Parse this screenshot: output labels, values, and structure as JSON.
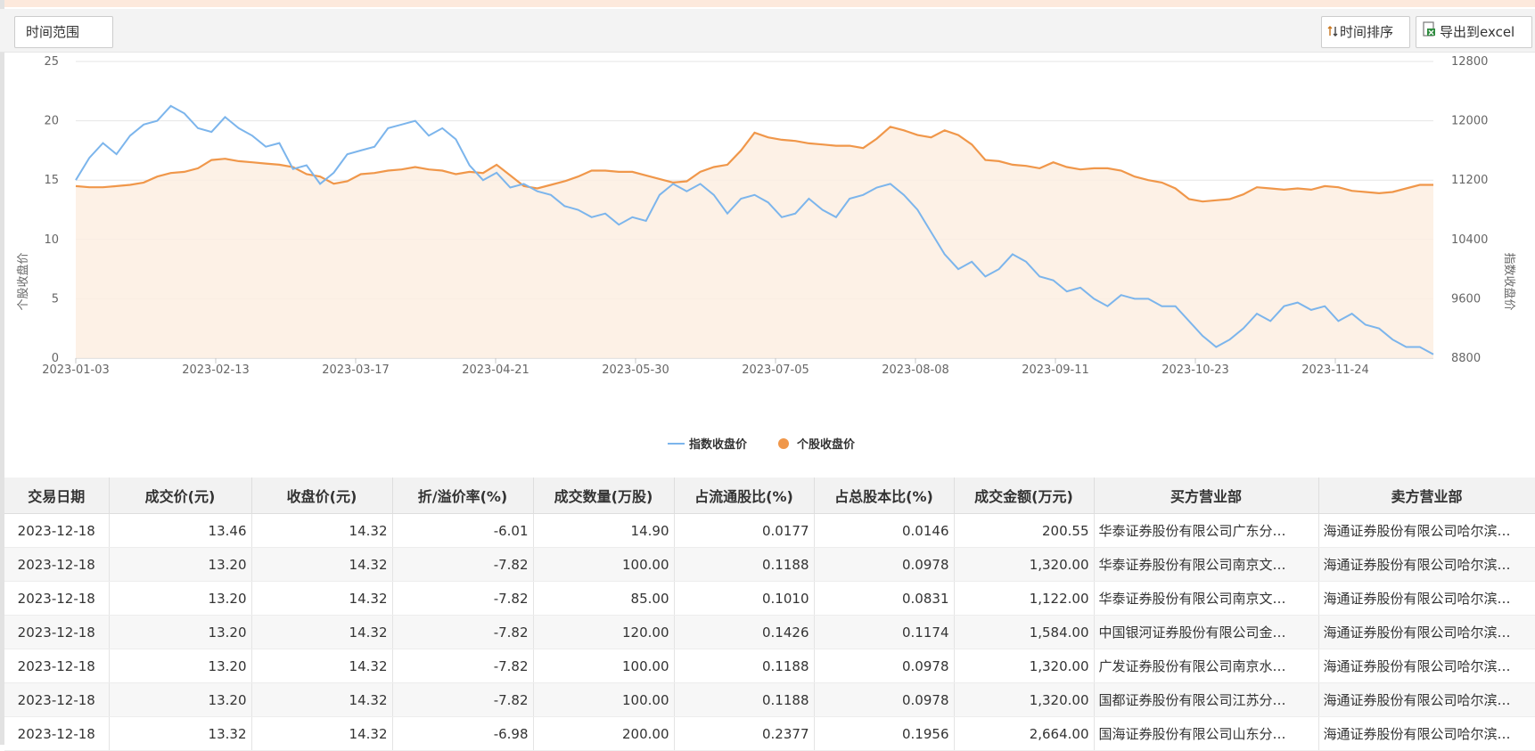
{
  "toolbar": {
    "range_label": "时间范围",
    "sort_label": "时间排序",
    "export_label": "导出到excel",
    "sort_icon": "sort-arrows-icon",
    "export_icon": "excel-export-icon"
  },
  "chart_data": {
    "type": "line",
    "title": "",
    "x_ticks": [
      "2023-01-03",
      "2023-02-13",
      "2023-03-17",
      "2023-04-21",
      "2023-05-30",
      "2023-07-05",
      "2023-08-08",
      "2023-09-11",
      "2023-10-23",
      "2023-11-24"
    ],
    "y_left": {
      "label": "个股收盘价",
      "range": [
        0,
        25
      ],
      "ticks": [
        "0",
        "5",
        "10",
        "15",
        "20",
        "25"
      ]
    },
    "y_right": {
      "label": "指数收盘价",
      "range": [
        8800,
        12800
      ],
      "ticks": [
        "8800",
        "9600",
        "10400",
        "11200",
        "12000",
        "12800"
      ]
    },
    "grid": true,
    "legend_position": "bottom-center",
    "series": [
      {
        "name": "指数收盘价",
        "axis": "right",
        "color": "#7cb5ec",
        "style": "line",
        "values": [
          11200,
          11500,
          11700,
          11550,
          11800,
          11950,
          12000,
          12200,
          12100,
          11900,
          11850,
          12050,
          11900,
          11800,
          11650,
          11700,
          11350,
          11400,
          11150,
          11300,
          11550,
          11600,
          11650,
          11900,
          11950,
          12000,
          11800,
          11900,
          11750,
          11400,
          11200,
          11300,
          11100,
          11150,
          11050,
          11000,
          10850,
          10800,
          10700,
          10750,
          10600,
          10700,
          10650,
          11000,
          11150,
          11050,
          11150,
          11000,
          10750,
          10950,
          11000,
          10900,
          10700,
          10750,
          10950,
          10800,
          10700,
          10950,
          11000,
          11100,
          11150,
          11000,
          10800,
          10500,
          10200,
          10000,
          10100,
          9900,
          10000,
          10200,
          10100,
          9900,
          9850,
          9700,
          9750,
          9600,
          9500,
          9650,
          9600,
          9600,
          9500,
          9500,
          9300,
          9100,
          8950,
          9050,
          9200,
          9400,
          9300,
          9500,
          9550,
          9450,
          9500,
          9300,
          9400,
          9250,
          9200,
          9050,
          8950,
          8950,
          8850
        ]
      },
      {
        "name": "个股收盘价",
        "axis": "left",
        "color": "#f0974a",
        "style": "area",
        "values": [
          14.5,
          14.4,
          14.4,
          14.5,
          14.6,
          14.8,
          15.3,
          15.6,
          15.7,
          16.0,
          16.7,
          16.8,
          16.6,
          16.5,
          16.4,
          16.3,
          16.1,
          15.5,
          15.3,
          14.7,
          14.9,
          15.5,
          15.6,
          15.8,
          15.9,
          16.1,
          15.9,
          15.8,
          15.5,
          15.7,
          15.6,
          16.3,
          15.4,
          14.5,
          14.3,
          14.6,
          14.9,
          15.3,
          15.8,
          15.8,
          15.7,
          15.7,
          15.4,
          15.1,
          14.8,
          14.9,
          15.7,
          16.1,
          16.3,
          17.5,
          19.0,
          18.6,
          18.4,
          18.3,
          18.1,
          18.0,
          17.9,
          17.9,
          17.7,
          18.5,
          19.5,
          19.2,
          18.8,
          18.6,
          19.2,
          18.8,
          18.0,
          16.7,
          16.6,
          16.3,
          16.2,
          16.0,
          16.5,
          16.1,
          15.9,
          16.0,
          16.0,
          15.8,
          15.3,
          15.0,
          14.8,
          14.3,
          13.4,
          13.2,
          13.3,
          13.4,
          13.8,
          14.4,
          14.3,
          14.2,
          14.3,
          14.2,
          14.5,
          14.4,
          14.1,
          14.0,
          13.9,
          14.0,
          14.3,
          14.6,
          14.6
        ]
      }
    ]
  },
  "table": {
    "headers": [
      "交易日期",
      "成交价(元)",
      "收盘价(元)",
      "折/溢价率(%)",
      "成交数量(万股)",
      "占流通股比(%)",
      "占总股本比(%)",
      "成交金额(万元)",
      "买方营业部",
      "卖方营业部"
    ],
    "rows": [
      [
        "2023-12-18",
        "13.46",
        "14.32",
        "-6.01",
        "14.90",
        "0.0177",
        "0.0146",
        "200.55",
        "华泰证券股份有限公司广东分…",
        "海通证券股份有限公司哈尔滨…"
      ],
      [
        "2023-12-18",
        "13.20",
        "14.32",
        "-7.82",
        "100.00",
        "0.1188",
        "0.0978",
        "1,320.00",
        "华泰证券股份有限公司南京文…",
        "海通证券股份有限公司哈尔滨…"
      ],
      [
        "2023-12-18",
        "13.20",
        "14.32",
        "-7.82",
        "85.00",
        "0.1010",
        "0.0831",
        "1,122.00",
        "华泰证券股份有限公司南京文…",
        "海通证券股份有限公司哈尔滨…"
      ],
      [
        "2023-12-18",
        "13.20",
        "14.32",
        "-7.82",
        "120.00",
        "0.1426",
        "0.1174",
        "1,584.00",
        "中国银河证券股份有限公司金…",
        "海通证券股份有限公司哈尔滨…"
      ],
      [
        "2023-12-18",
        "13.20",
        "14.32",
        "-7.82",
        "100.00",
        "0.1188",
        "0.0978",
        "1,320.00",
        "广发证券股份有限公司南京水…",
        "海通证券股份有限公司哈尔滨…"
      ],
      [
        "2023-12-18",
        "13.20",
        "14.32",
        "-7.82",
        "100.00",
        "0.1188",
        "0.0978",
        "1,320.00",
        "国都证券股份有限公司江苏分…",
        "海通证券股份有限公司哈尔滨…"
      ],
      [
        "2023-12-18",
        "13.32",
        "14.32",
        "-6.98",
        "200.00",
        "0.2377",
        "0.1956",
        "2,664.00",
        "国海证券股份有限公司山东分…",
        "海通证券股份有限公司哈尔滨…"
      ]
    ]
  }
}
